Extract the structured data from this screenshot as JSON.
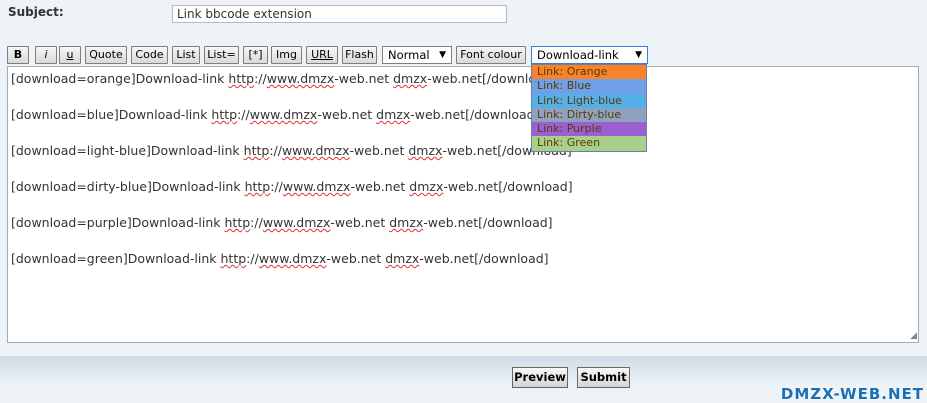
{
  "subject": {
    "label": "Subject:",
    "value": "Link bbcode extension"
  },
  "toolbar": {
    "bold": "B",
    "italic": "i",
    "underline": "u",
    "quote": "Quote",
    "code": "Code",
    "list": "List",
    "list_ordered": "List=",
    "list_item": "[*]",
    "img": "Img",
    "url": "URL",
    "flash": "Flash",
    "font_size": "Normal",
    "font_colour": "Font colour",
    "download_select": "Download-link"
  },
  "download_options": [
    {
      "label": "Link: Orange",
      "color": "#f8832b"
    },
    {
      "label": "Link: Blue",
      "color": "#6fa0e8"
    },
    {
      "label": "Link: Light-blue",
      "color": "#56b0e8"
    },
    {
      "label": "Link: Dirty-blue",
      "color": "#8ea2c0"
    },
    {
      "label": "Link: Purple",
      "color": "#9c5fd0"
    },
    {
      "label": "Link: Green",
      "color": "#a9d08a"
    }
  ],
  "editor": {
    "lines": [
      {
        "pre": "[download=orange]Download-link ",
        "s1": "http",
        "mid": "://",
        "s2": "www.dmzx",
        "post": "-web.net ",
        "s3": "dmzx",
        "end": "-web.net[/download]"
      },
      {
        "pre": "[download=blue]Download-link ",
        "s1": "http",
        "mid": "://",
        "s2": "www.dmzx",
        "post": "-web.net ",
        "s3": "dmzx",
        "end": "-web.net[/download]"
      },
      {
        "pre": "[download=light-blue]Download-link ",
        "s1": "http",
        "mid": "://",
        "s2": "www.dmzx",
        "post": "-web.net ",
        "s3": "dmzx",
        "end": "-web.net[/download]"
      },
      {
        "pre": "[download=dirty-blue]Download-link ",
        "s1": "http",
        "mid": "://",
        "s2": "www.dmzx",
        "post": "-web.net ",
        "s3": "dmzx",
        "end": "-web.net[/download]"
      },
      {
        "pre": "[download=purple]Download-link ",
        "s1": "http",
        "mid": "://",
        "s2": "www.dmzx",
        "post": "-web.net ",
        "s3": "dmzx",
        "end": "-web.net[/download]"
      },
      {
        "pre": "[download=green]Download-link ",
        "s1": "http",
        "mid": "://",
        "s2": "www.dmzx",
        "post": "-web.net ",
        "s3": "dmzx",
        "end": "-web.net[/download]"
      }
    ]
  },
  "actions": {
    "preview": "Preview",
    "submit": "Submit"
  },
  "watermark": "DMZX-WEB.NET"
}
